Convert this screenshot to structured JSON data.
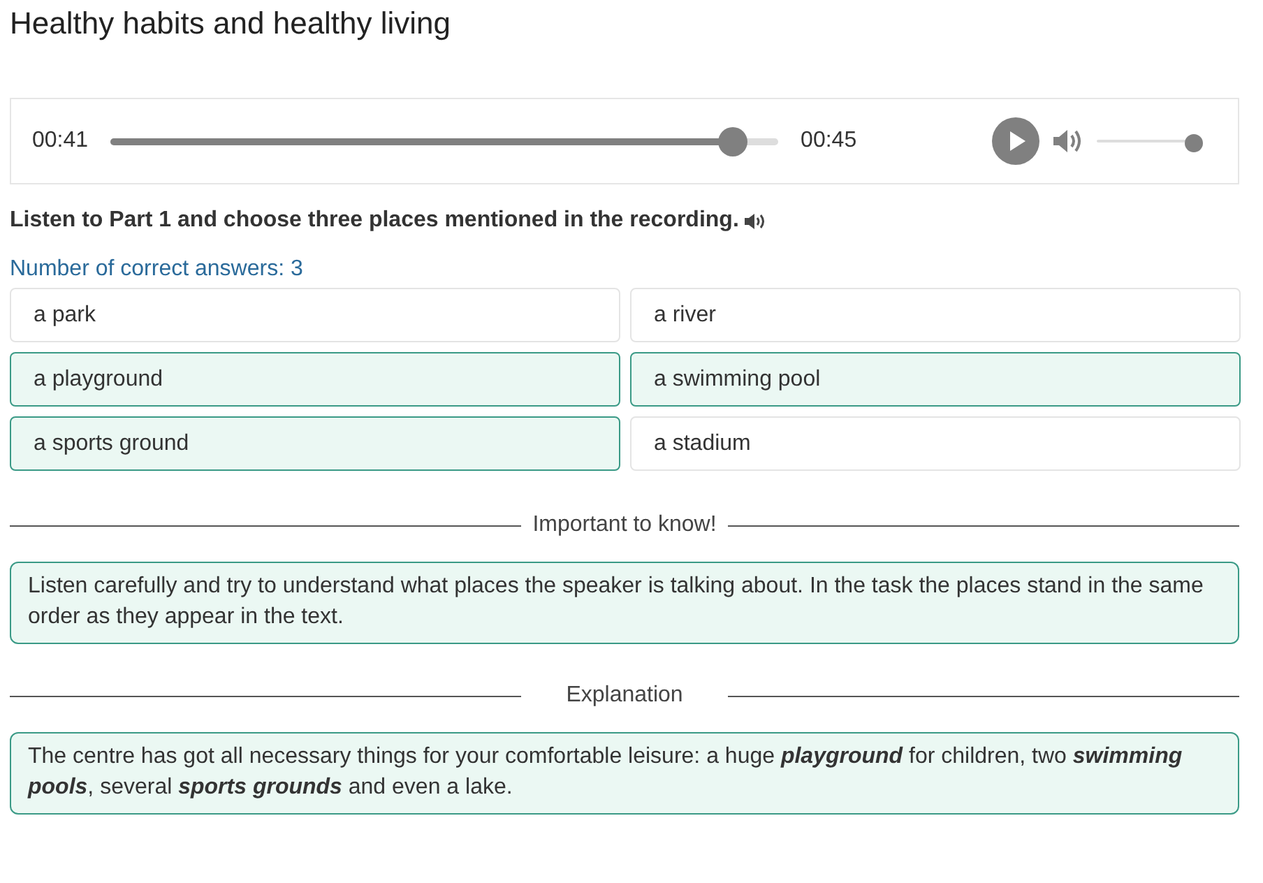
{
  "title": "Healthy habits and healthy living",
  "player": {
    "current_time": "00:41",
    "duration": "00:45",
    "level": 0.93,
    "volume": {
      "level": 1.0
    }
  },
  "instruction": "Listen to Part 1 and choose three places mentioned in the recording.",
  "answer_count": "Number of correct answers: 3",
  "options": [
    {
      "label": "a park",
      "selected": false
    },
    {
      "label": "a river",
      "selected": false
    },
    {
      "label": "a playground",
      "selected": true
    },
    {
      "label": "a swimming pool",
      "selected": true
    },
    {
      "label": "a sports ground",
      "selected": true
    },
    {
      "label": "a stadium",
      "selected": false
    }
  ],
  "sections": [
    {
      "heading": "Important to know!",
      "text": "Listen carefully and try to understand what places the speaker is talking about. In the task the places stand in the same order as they appear in the text."
    },
    {
      "heading": "Explanation",
      "text": "The centre has got all necessary things for your comfortable leisure: a huge **playground** for children, two **swimming pools**, several **sports grounds** and even a lake."
    }
  ]
}
